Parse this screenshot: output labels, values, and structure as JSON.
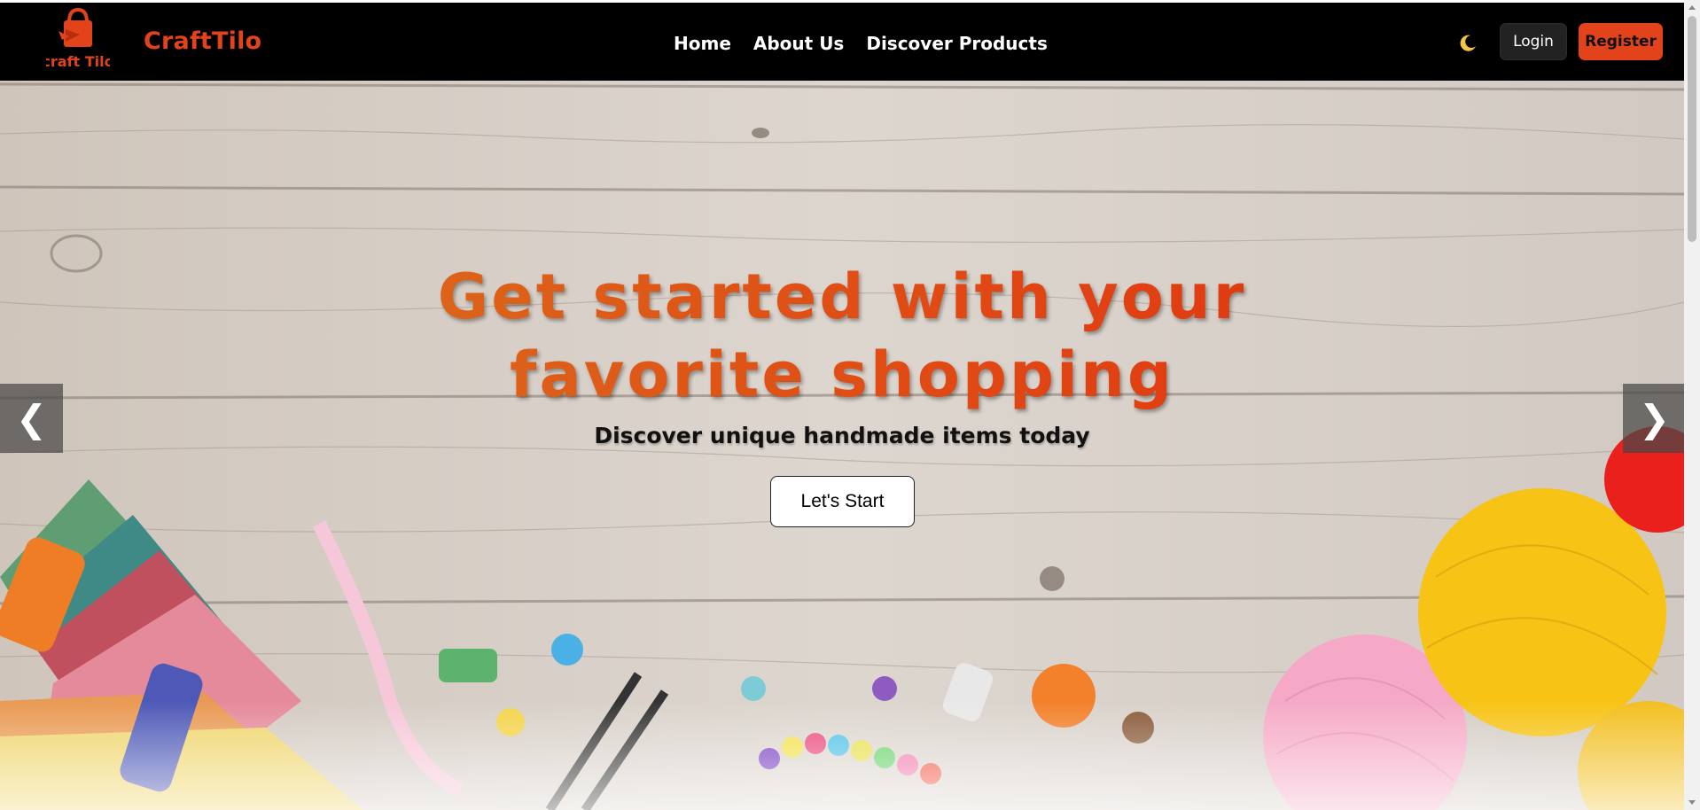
{
  "app": {
    "brand": "CraftTilo",
    "logo_text": "craft Tilo",
    "accent_color": "#e3431a"
  },
  "nav": {
    "links": [
      {
        "label": "Home"
      },
      {
        "label": "About Us"
      },
      {
        "label": "Discover Products"
      }
    ],
    "theme_toggle_icon": "moon-icon",
    "login_label": "Login",
    "register_label": "Register"
  },
  "hero": {
    "title_line1": "Get started with your",
    "title_line2": "favorite shopping",
    "subtitle": "Discover unique handmade items today",
    "cta_label": "Let's Start",
    "prev_arrow": "❮",
    "next_arrow": "❯",
    "background": "craft-supplies-on-wood-icon"
  }
}
